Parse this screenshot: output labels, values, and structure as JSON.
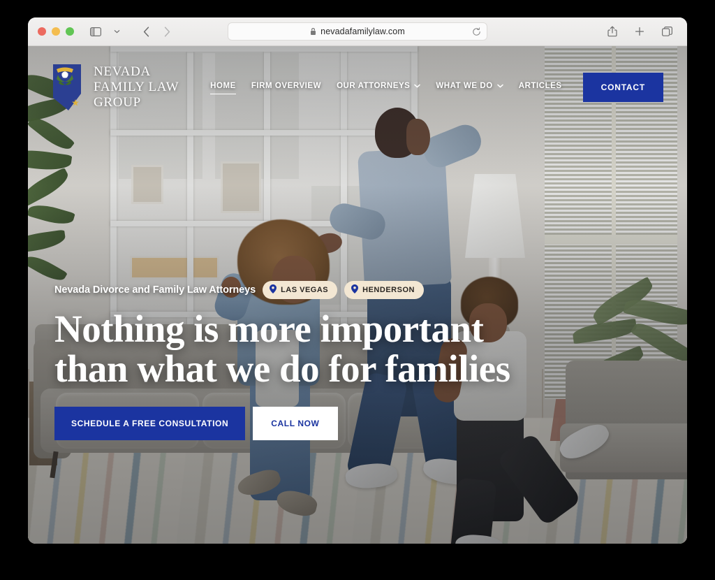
{
  "browser": {
    "url": "nevadafamilylaw.com",
    "lock_icon": "lock-icon",
    "reload_icon": "reload-icon",
    "sidebar_icon": "sidebar-toggle-icon",
    "sidebar_chevron_icon": "chevron-down-icon",
    "back_icon": "back-arrow-icon",
    "forward_icon": "forward-arrow-icon",
    "share_icon": "share-icon",
    "newtab_icon": "plus-icon",
    "tabs_icon": "tab-overview-icon",
    "traffic_lights": [
      "close-red",
      "minimize-yellow",
      "zoom-green"
    ]
  },
  "site": {
    "logo": {
      "mark": "nevada-state-outline-icon",
      "line1": "NEVADA",
      "line2": "FAMILY LAW",
      "line3": "GROUP"
    },
    "nav": [
      {
        "label": "HOME",
        "active": true,
        "dropdown": false
      },
      {
        "label": "FIRM OVERVIEW",
        "active": false,
        "dropdown": false
      },
      {
        "label": "OUR ATTORNEYS",
        "active": false,
        "dropdown": true
      },
      {
        "label": "WHAT WE DO",
        "active": false,
        "dropdown": true
      },
      {
        "label": "ARTICLES",
        "active": false,
        "dropdown": false
      }
    ],
    "contact_button": "CONTACT",
    "hero": {
      "eyebrow": "Nevada Divorce and Family Law Attorneys",
      "locations": [
        {
          "label": "LAS VEGAS",
          "icon": "map-pin-icon"
        },
        {
          "label": "HENDERSON",
          "icon": "map-pin-icon"
        }
      ],
      "headline_line1": "Nothing is more important",
      "headline_line2": "than what we do for families",
      "cta_primary": "SCHEDULE A FREE CONSULTATION",
      "cta_secondary": "CALL NOW"
    }
  },
  "colors": {
    "brand_blue": "#1b34a0",
    "pill_cream": "#f3e7d3",
    "white": "#ffffff",
    "page_backdrop": "#000000"
  }
}
